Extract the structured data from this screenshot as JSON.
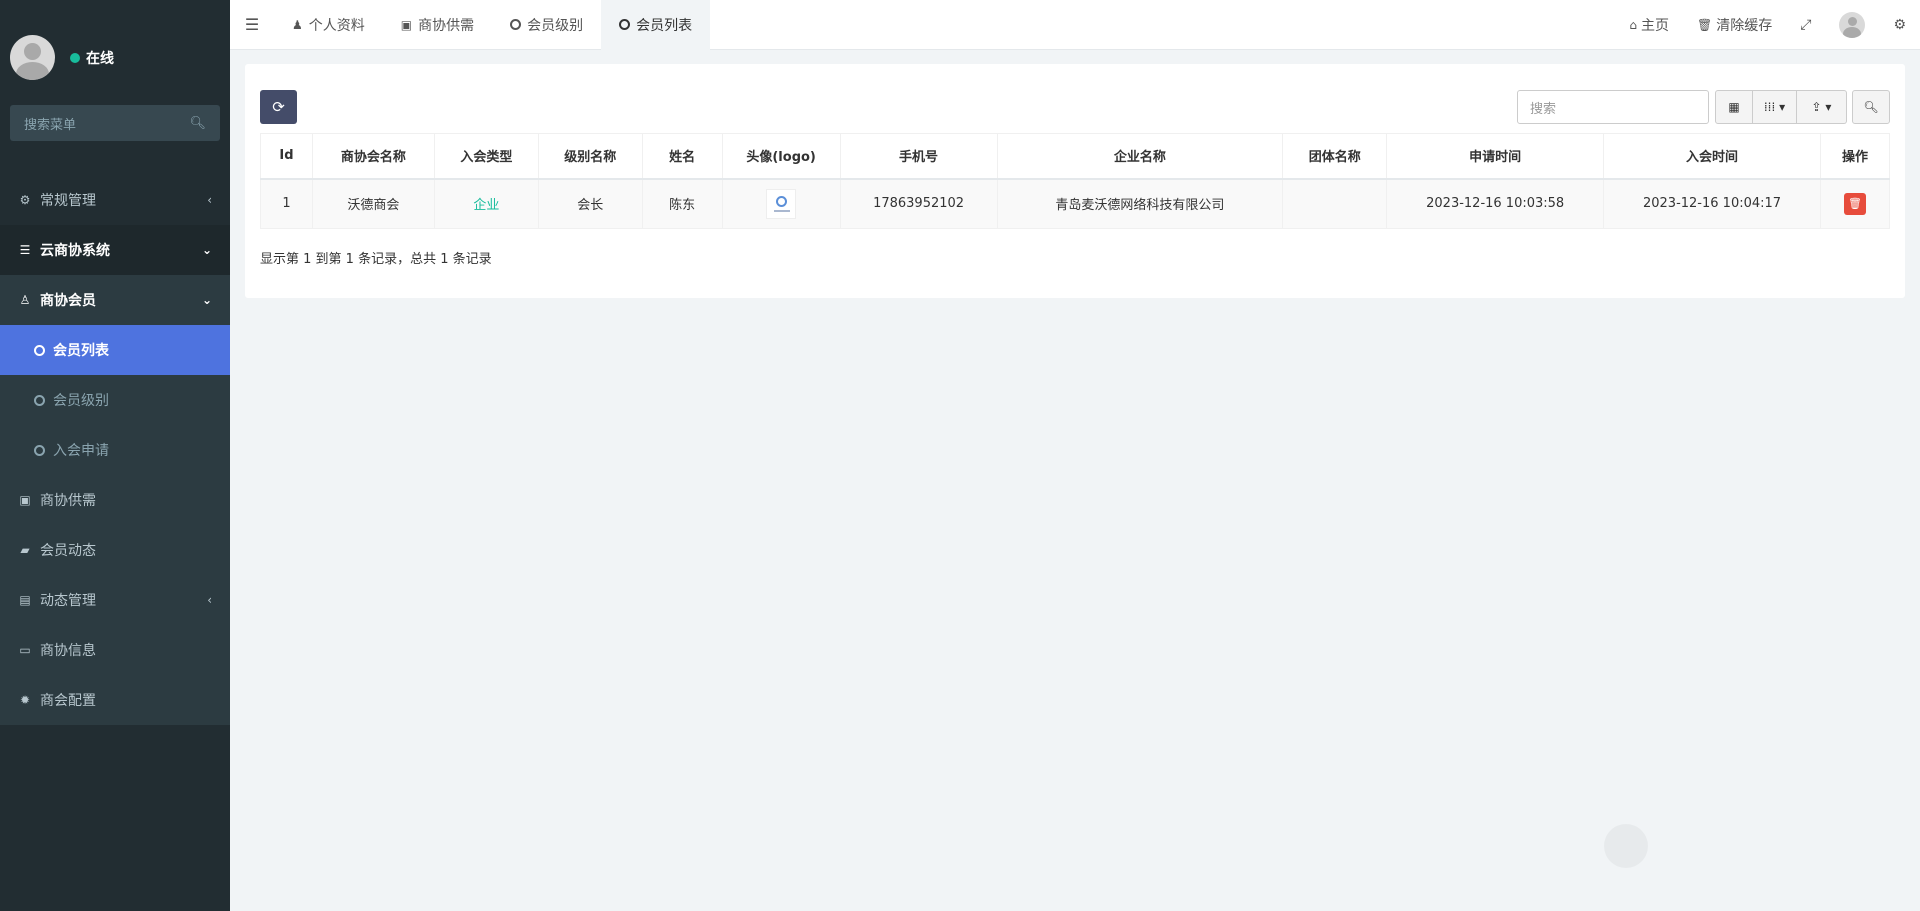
{
  "user": {
    "status": "在线"
  },
  "sidebar": {
    "search_placeholder": "搜索菜单",
    "items": [
      {
        "label": "常规管理",
        "icon": "cogs-icon",
        "arrow": "‹"
      },
      {
        "label": "云商协系统",
        "icon": "list-icon",
        "arrow": "⌄"
      },
      {
        "label": "商协会员",
        "icon": "user-icon",
        "arrow": "⌄"
      },
      {
        "label": "商协供需",
        "icon": "shopping-bag-icon"
      },
      {
        "label": "会员动态",
        "icon": "book-icon"
      },
      {
        "label": "动态管理",
        "icon": "newspaper-icon",
        "arrow": "‹"
      },
      {
        "label": "商协信息",
        "icon": "id-card-icon"
      },
      {
        "label": "商会配置",
        "icon": "gear-icon"
      }
    ],
    "subitems": [
      {
        "label": "会员列表"
      },
      {
        "label": "会员级别"
      },
      {
        "label": "入会申请"
      }
    ]
  },
  "navbar": {
    "tabs": [
      {
        "label": "个人资料"
      },
      {
        "label": "商协供需"
      },
      {
        "label": "会员级别"
      },
      {
        "label": "会员列表"
      }
    ],
    "home_label": "主页",
    "clear_cache_label": "清除缓存"
  },
  "toolbar": {
    "search_placeholder": "搜索"
  },
  "table": {
    "columns": [
      "Id",
      "商协会名称",
      "入会类型",
      "级别名称",
      "姓名",
      "头像(logo)",
      "手机号",
      "企业名称",
      "团体名称",
      "申请时间",
      "入会时间",
      "操作"
    ],
    "rows": [
      {
        "id": "1",
        "association": "沃德商会",
        "join_type": "企业",
        "level": "会长",
        "name": "陈东",
        "phone": "17863952102",
        "company": "青岛麦沃德网络科技有限公司",
        "group": "",
        "apply_time": "2023-12-16 10:03:58",
        "join_time": "2023-12-16 10:04:17"
      }
    ]
  },
  "pagination": {
    "summary": "显示第 1 到第 1 条记录，总共 1 条记录"
  },
  "colors": {
    "sidebar_bg": "#222d32",
    "active_item": "#4e73df",
    "online": "#18bc9c",
    "danger": "#e74c3c",
    "refresh_btn": "#444c69"
  }
}
